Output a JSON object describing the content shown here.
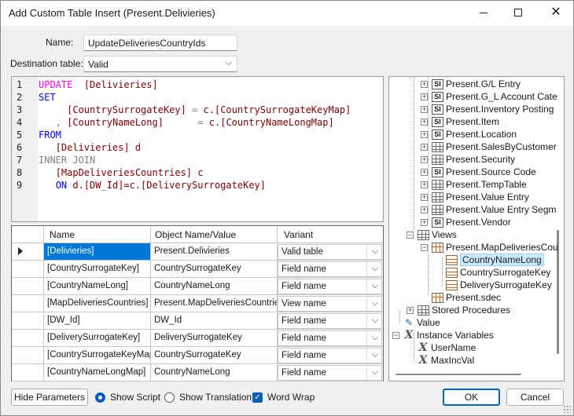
{
  "window": {
    "title": "Add Custom Table Insert (Present.Delivieries)"
  },
  "form": {
    "name_label": "Name:",
    "name_value": "UpdateDeliveriesCountryIds",
    "dest_label": "Destination table:",
    "dest_value": "Valid"
  },
  "script": {
    "lines": [
      {
        "n": "1",
        "parts": [
          [
            "kw-pink",
            "UPDATE"
          ],
          [
            "",
            "  "
          ],
          [
            "id",
            "[Delivieries]"
          ]
        ]
      },
      {
        "n": "2",
        "parts": [
          [
            "kw",
            "SET"
          ]
        ]
      },
      {
        "n": "3",
        "parts": [
          [
            "",
            "     "
          ],
          [
            "id",
            "[CountrySurrogateKey]"
          ],
          [
            "op",
            " = "
          ],
          [
            "id",
            "c.[CountrySurrogateKeyMap]"
          ]
        ]
      },
      {
        "n": "4",
        "parts": [
          [
            "",
            "   "
          ],
          [
            "op",
            ", "
          ],
          [
            "id",
            "[CountryNameLong]"
          ],
          [
            "op",
            "      = "
          ],
          [
            "id",
            "c.[CountryNameLongMap]"
          ]
        ]
      },
      {
        "n": "5",
        "parts": [
          [
            "kw",
            "FROM"
          ]
        ]
      },
      {
        "n": "6",
        "parts": [
          [
            "",
            "   "
          ],
          [
            "id",
            "[Delivieries] d"
          ]
        ]
      },
      {
        "n": "7",
        "parts": [
          [
            "kw-gray",
            "INNER JOIN"
          ]
        ]
      },
      {
        "n": "8",
        "parts": [
          [
            "",
            "   "
          ],
          [
            "id",
            "[MapDeliveriesCountries] c"
          ]
        ]
      },
      {
        "n": "9",
        "parts": [
          [
            "",
            "   "
          ],
          [
            "kw",
            "ON"
          ],
          [
            "id",
            " d.[DW_Id]=c.[DeliverySurrogateKey]"
          ]
        ]
      }
    ]
  },
  "grid": {
    "headers": [
      "Name",
      "Object Name/Value",
      "Variant"
    ],
    "rows": [
      {
        "name": "[Delivieries]",
        "object": "Present.Delivieries",
        "variant": "Valid table"
      },
      {
        "name": "[CountrySurrogateKey]",
        "object": "CountrySurrogateKey",
        "variant": "Field name"
      },
      {
        "name": "[CountryNameLong]",
        "object": "CountryNameLong",
        "variant": "Field name"
      },
      {
        "name": "[MapDeliveriesCountries]",
        "object": "Present.MapDeliveriesCountries",
        "variant": "View name"
      },
      {
        "name": "[DW_Id]",
        "object": "DW_Id",
        "variant": "Field name"
      },
      {
        "name": "[DeliverySurrogateKey]",
        "object": "DeliverySurrogateKey",
        "variant": "Field name"
      },
      {
        "name": "[CountrySurrogateKeyMap]",
        "object": "CountrySurrogateKey",
        "variant": "Field name"
      },
      {
        "name": "[CountryNameLongMap]",
        "object": "CountryNameLong",
        "variant": "Field name"
      }
    ]
  },
  "tree": {
    "nodes": [
      {
        "label": "Present.G/L Entry",
        "icon": "si-table-icon"
      },
      {
        "label": "Present.G_L Account Cate",
        "icon": "si-table-icon"
      },
      {
        "label": "Present.Inventory Posting",
        "icon": "si-table-icon"
      },
      {
        "label": "Present.Item",
        "icon": "si-table-icon"
      },
      {
        "label": "Present.Location",
        "icon": "si-table-icon"
      },
      {
        "label": "Present.SalesByCustomer",
        "icon": "table-icon"
      },
      {
        "label": "Present.Security",
        "icon": "table-icon"
      },
      {
        "label": "Present.Source Code",
        "icon": "si-table-icon"
      },
      {
        "label": "Present.TempTable",
        "icon": "table-icon"
      },
      {
        "label": "Present.Value Entry",
        "icon": "table-icon"
      },
      {
        "label": "Present.Value Entry Segm",
        "icon": "table-icon"
      },
      {
        "label": "Present.Vendor",
        "icon": "si-table-icon"
      },
      {
        "label": "Views",
        "icon": "views-folder-icon"
      },
      {
        "label": "Present.MapDeliveriesCou",
        "icon": "view-icon"
      },
      {
        "label": "CountryNameLong",
        "icon": "column-icon"
      },
      {
        "label": "CountrySurrogateKey",
        "icon": "column-icon"
      },
      {
        "label": "DeliverySurrogateKey",
        "icon": "column-icon"
      },
      {
        "label": "Present.sdec",
        "icon": "view-icon"
      },
      {
        "label": "Stored Procedures",
        "icon": "stored-procedures-icon"
      },
      {
        "label": "Value",
        "icon": "value-icon"
      },
      {
        "label": "Instance Variables",
        "icon": "instance-variables-icon"
      },
      {
        "label": "UserName",
        "icon": "variable-icon"
      },
      {
        "label": "MaxIncVal",
        "icon": "variable-icon"
      }
    ]
  },
  "footer": {
    "hide_params": "Hide Parameters",
    "show_script": "Show Script",
    "show_translation": "Show Translation",
    "word_wrap": "Word Wrap",
    "ok": "OK",
    "cancel": "Cancel"
  }
}
